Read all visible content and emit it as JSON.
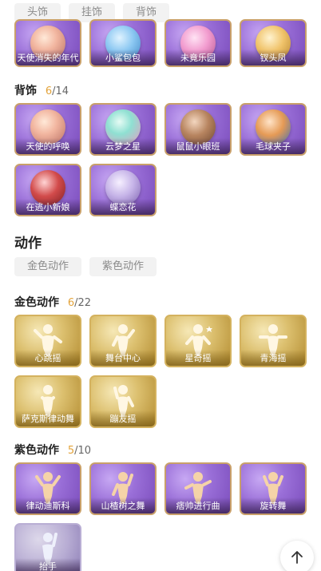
{
  "top_chips": [
    "头饰",
    "挂饰",
    "背饰"
  ],
  "accessory_row_top": [
    {
      "label": "天使消失的年代",
      "icon": "angel-figure"
    },
    {
      "label": "小鲨包包",
      "icon": "shark-bag"
    },
    {
      "label": "未竟乐园",
      "icon": "paradise-figure"
    },
    {
      "label": "钗头凤",
      "icon": "phoenix-hairpin"
    }
  ],
  "back_section": {
    "title": "背饰",
    "owned": "6",
    "total": "/14",
    "items": [
      {
        "label": "天使的呼唤",
        "icon": "angel-doll"
      },
      {
        "label": "云梦之星",
        "icon": "dream-star"
      },
      {
        "label": "鼠鼠小眼班",
        "icon": "mouse-figure"
      },
      {
        "label": "毛球夹子",
        "icon": "furball-clip"
      },
      {
        "label": "在逃小新娘",
        "icon": "bride-figure"
      },
      {
        "label": "蝶恋花",
        "icon": "butterfly-flower"
      }
    ]
  },
  "actions": {
    "title": "动作",
    "chips": [
      "金色动作",
      "紫色动作"
    ]
  },
  "gold_section": {
    "title": "金色动作",
    "owned": "6",
    "total": "/22",
    "items": [
      {
        "label": "心跳摇",
        "icon": "heartbeat-dance"
      },
      {
        "label": "舞台中心",
        "icon": "stage-center-dance"
      },
      {
        "label": "星奇摇",
        "icon": "star-dance"
      },
      {
        "label": "青海摇",
        "icon": "qinghai-dance"
      },
      {
        "label": "萨克斯律动舞",
        "icon": "sax-dance"
      },
      {
        "label": "蹦友摇",
        "icon": "friend-dance"
      }
    ]
  },
  "purple_section": {
    "title": "紫色动作",
    "owned": "5",
    "total": "/10",
    "items": [
      {
        "label": "律动迪斯科",
        "icon": "disco-dance"
      },
      {
        "label": "山楂树之舞",
        "icon": "hawthorn-dance"
      },
      {
        "label": "痞帅进行曲",
        "icon": "march-dance"
      },
      {
        "label": "旋转舞",
        "icon": "spin-dance"
      },
      {
        "label": "抬手",
        "icon": "raise-hand"
      }
    ]
  },
  "colors": {
    "owned_count": "#e3a33b",
    "chip_bg": "#f2f2f2",
    "purple_tile": "#9a6fd8",
    "gold_tile": "#dcc06f"
  }
}
